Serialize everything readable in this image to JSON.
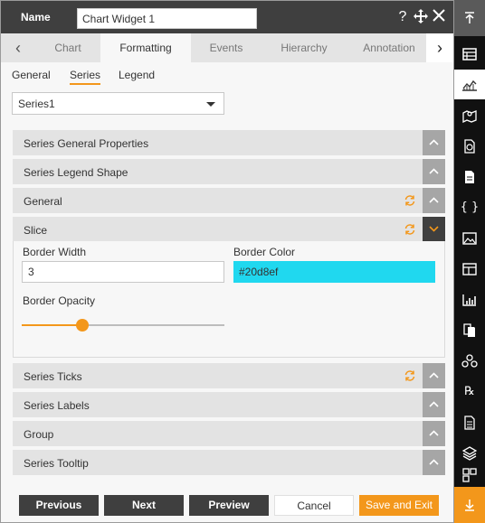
{
  "header": {
    "name_label": "Name",
    "name_value": "Chart Widget 1"
  },
  "tabs": [
    {
      "label": "Chart"
    },
    {
      "label": "Formatting"
    },
    {
      "label": "Events"
    },
    {
      "label": "Hierarchy"
    },
    {
      "label": "Annotation"
    }
  ],
  "subtabs": [
    {
      "label": "General"
    },
    {
      "label": "Series"
    },
    {
      "label": "Legend"
    }
  ],
  "series_select": {
    "value": "Series1"
  },
  "sections": [
    {
      "label": "Series General Properties"
    },
    {
      "label": "Series Legend Shape"
    },
    {
      "label": "General"
    },
    {
      "label": "Slice"
    },
    {
      "label": "Series Ticks"
    },
    {
      "label": "Series Labels"
    },
    {
      "label": "Group"
    },
    {
      "label": "Series Tooltip"
    }
  ],
  "slice": {
    "border_width_label": "Border Width",
    "border_width_value": "3",
    "border_color_label": "Border Color",
    "border_color_value": "#20d8ef",
    "border_opacity_label": "Border Opacity",
    "border_opacity_fraction": 0.3
  },
  "footer": {
    "previous": "Previous",
    "next": "Next",
    "preview": "Preview",
    "cancel": "Cancel",
    "save_exit": "Save and Exit"
  },
  "colors": {
    "accent": "#f3971b",
    "header_bg": "#3f3f3f",
    "section_bg": "#e3e3e3",
    "border_color_swatch": "#20d8ef"
  },
  "rail_icons": [
    "collapse-up-icon",
    "table-icon",
    "chart-icon",
    "map-icon",
    "report-icon",
    "document-icon",
    "code-braces-icon",
    "image-icon",
    "grid-form-icon",
    "bar-chart-icon",
    "pages-icon",
    "hierarchy-icon",
    "rx-icon",
    "file-list-icon",
    "layers-icon",
    "components-icon",
    "expand-down-icon"
  ]
}
